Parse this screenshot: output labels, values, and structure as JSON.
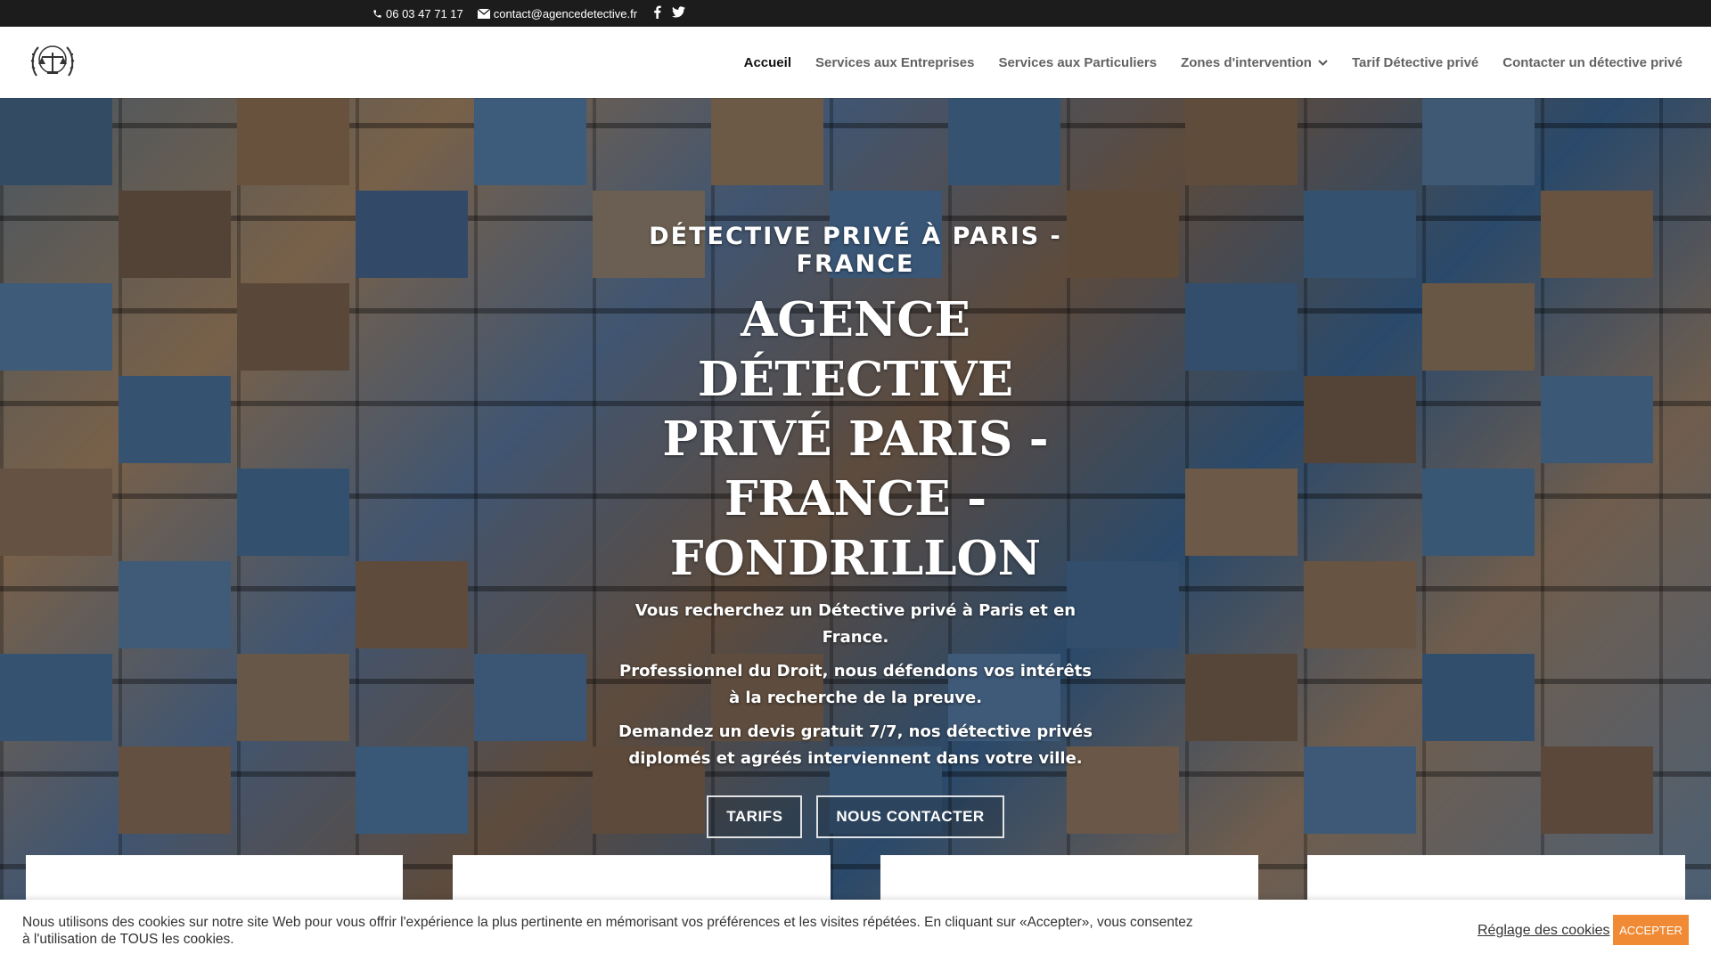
{
  "topbar": {
    "phone": "06 03 47 71 17",
    "email": "contact@agencedetective.fr",
    "social": [
      "facebook-icon",
      "twitter-icon"
    ]
  },
  "nav": {
    "items": [
      {
        "label": "Accueil"
      },
      {
        "label": "Services aux Entreprises"
      },
      {
        "label": "Services aux Particuliers"
      },
      {
        "label": "Zones d'intervention"
      },
      {
        "label": "Tarif Détective privé"
      },
      {
        "label": "Contacter un détective privé"
      }
    ]
  },
  "hero": {
    "subtitle": "DÉTECTIVE PRIVÉ À PARIS - FRANCE",
    "title": "AGENCE DÉTECTIVE PRIVÉ PARIS - FRANCE - FONDRILLON",
    "line1": "Vous recherchez un Détective privé à Paris et en France.",
    "line2": "Professionnel du Droit, nous défendons vos intérêts à la recherche de la preuve.",
    "line3": "Demandez un devis gratuit 7/7, nos détective privés diplomés et agréés interviennent dans votre ville.",
    "btn_tarifs": "TARIFS",
    "btn_contact": "NOUS CONTACTER"
  },
  "cookie": {
    "text": "Nous utilisons des cookies sur notre site Web pour vous offrir l'expérience la plus pertinente en mémorisant vos préférences et les visites répétées. En cliquant sur «Accepter», vous consentez à l'utilisation de TOUS les cookies.",
    "settings": "Réglage des cookies",
    "accept": "ACCEPTER"
  },
  "colors": {
    "topbar_bg": "#1c1c1c",
    "accent": "#f08a34"
  }
}
